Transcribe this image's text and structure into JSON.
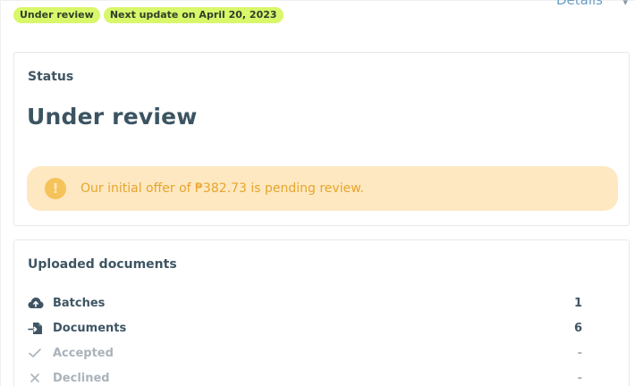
{
  "header": {
    "badges": [
      "Under review",
      "Next update on April 20, 2023"
    ],
    "details_label": "Details"
  },
  "status_card": {
    "title": "Status",
    "status_value": "Under review",
    "alert": {
      "icon": "exclamation-icon",
      "text": "Our initial offer of ₱382.73 is pending review."
    }
  },
  "documents_card": {
    "title": "Uploaded documents",
    "rows": [
      {
        "icon": "cloud-upload-icon",
        "label": "Batches",
        "value": "1"
      },
      {
        "icon": "document-import-icon",
        "label": "Documents",
        "value": "6"
      },
      {
        "icon": "check-icon",
        "label": "Accepted",
        "value": "-"
      },
      {
        "icon": "x-icon",
        "label": "Declined",
        "value": "-"
      }
    ]
  },
  "colors": {
    "badge_bg": "#d8f76a",
    "alert_bg": "#fde8c2",
    "alert_text": "#e7a52a",
    "heading": "#3c5462",
    "muted": "#a9b3bb",
    "link": "#6b9ec4"
  }
}
